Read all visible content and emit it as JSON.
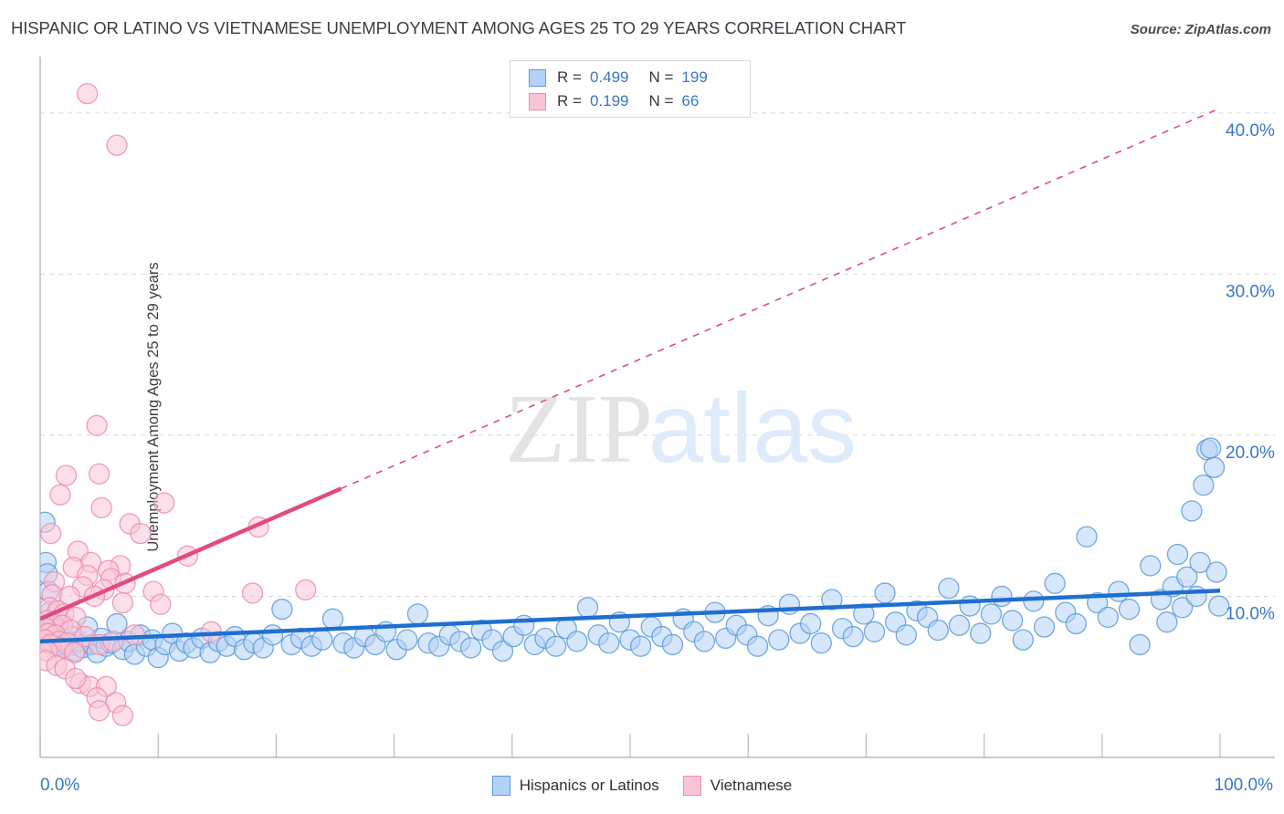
{
  "header": {
    "title": "HISPANIC OR LATINO VS VIETNAMESE UNEMPLOYMENT AMONG AGES 25 TO 29 YEARS CORRELATION CHART",
    "source": "Source: ZipAtlas.com"
  },
  "watermark": {
    "part1": "ZIP",
    "part2": "atlas"
  },
  "axes": {
    "ylabel": "Unemployment Among Ages 25 to 29 years",
    "y_ticks": [
      "40.0%",
      "30.0%",
      "20.0%",
      "10.0%"
    ],
    "x_min_label": "0.0%",
    "x_max_label": "100.0%"
  },
  "legend": {
    "rows": [
      {
        "swatch": "blue",
        "r_key": "R =",
        "r_value": "0.499",
        "n_key": "N =",
        "n_value": "199"
      },
      {
        "swatch": "pink",
        "r_key": "R =",
        "r_value": "0.199",
        "n_key": "N =",
        "n_value": "66"
      }
    ]
  },
  "series_legend": [
    {
      "label": "Hispanics or Latinos",
      "color": "#b4d2f7",
      "border": "#5b9bd5"
    },
    {
      "label": "Vietnamese",
      "color": "#fac4d6",
      "border": "#ef8bb0"
    }
  ],
  "colors": {
    "blue_fill": "#b4d2f7",
    "blue_stroke": "#5b9bd5",
    "pink_fill": "#fac4d6",
    "pink_stroke": "#ef8bb0",
    "blue_line": "#1f6fd0",
    "pink_line": "#e14b7f",
    "tick_text": "#3a76c4",
    "grid": "#d8d8dd",
    "axis": "#b9b9c2"
  },
  "chart_data": {
    "type": "scatter",
    "title": "HISPANIC OR LATINO VS VIETNAMESE UNEMPLOYMENT AMONG AGES 25 TO 29 YEARS CORRELATION CHART",
    "xlabel": "",
    "ylabel": "Unemployment Among Ages 25 to 29 years",
    "xlim": [
      0,
      100
    ],
    "ylim": [
      0,
      43.5
    ],
    "x_ticks": [
      0,
      100
    ],
    "x_tick_labels": [
      "0.0%",
      "100.0%"
    ],
    "y_ticks": [
      10,
      20,
      30,
      40
    ],
    "y_tick_labels": [
      "10.0%",
      "20.0%",
      "30.0%",
      "40.0%"
    ],
    "grid": "horizontal-dashed",
    "legend_position": "top-center",
    "series": [
      {
        "name": "Hispanics or Latinos",
        "color": "#b4d2f7",
        "r": 0.499,
        "n": 199,
        "trend": {
          "style": "solid",
          "x0": 0,
          "y0": 7.2,
          "x1": 100,
          "y1": 10.35
        },
        "points": [
          [
            0.4,
            14.6
          ],
          [
            0.5,
            12.1
          ],
          [
            0.6,
            11.4
          ],
          [
            0.7,
            10.3
          ],
          [
            0.8,
            9.0
          ],
          [
            0.9,
            8.2
          ],
          [
            1.0,
            7.6
          ],
          [
            1.1,
            7.1
          ],
          [
            1.3,
            7.4
          ],
          [
            1.5,
            8.0
          ],
          [
            1.7,
            7.0
          ],
          [
            1.9,
            6.8
          ],
          [
            2.1,
            7.3
          ],
          [
            2.4,
            6.9
          ],
          [
            2.7,
            7.5
          ],
          [
            3.0,
            6.6
          ],
          [
            3.3,
            7.2
          ],
          [
            3.6,
            6.8
          ],
          [
            4.0,
            8.1
          ],
          [
            4.4,
            7.0
          ],
          [
            4.8,
            6.5
          ],
          [
            5.2,
            7.4
          ],
          [
            5.6,
            6.9
          ],
          [
            6.0,
            7.1
          ],
          [
            6.5,
            8.3
          ],
          [
            7.0,
            6.7
          ],
          [
            7.5,
            7.2
          ],
          [
            8.0,
            6.4
          ],
          [
            8.5,
            7.6
          ],
          [
            9.0,
            6.9
          ],
          [
            9.5,
            7.3
          ],
          [
            10.0,
            6.2
          ],
          [
            10.6,
            7.0
          ],
          [
            11.2,
            7.7
          ],
          [
            11.8,
            6.6
          ],
          [
            12.4,
            7.1
          ],
          [
            13.0,
            6.8
          ],
          [
            13.7,
            7.4
          ],
          [
            14.4,
            6.5
          ],
          [
            15.1,
            7.2
          ],
          [
            15.8,
            6.9
          ],
          [
            16.5,
            7.5
          ],
          [
            17.3,
            6.7
          ],
          [
            18.1,
            7.1
          ],
          [
            18.9,
            6.8
          ],
          [
            19.7,
            7.6
          ],
          [
            20.5,
            9.2
          ],
          [
            21.3,
            7.0
          ],
          [
            22.1,
            7.4
          ],
          [
            23.0,
            6.9
          ],
          [
            23.9,
            7.3
          ],
          [
            24.8,
            8.6
          ],
          [
            25.7,
            7.1
          ],
          [
            26.6,
            6.8
          ],
          [
            27.5,
            7.5
          ],
          [
            28.4,
            7.0
          ],
          [
            29.3,
            7.8
          ],
          [
            30.2,
            6.7
          ],
          [
            31.1,
            7.3
          ],
          [
            32.0,
            8.9
          ],
          [
            32.9,
            7.1
          ],
          [
            33.8,
            6.9
          ],
          [
            34.7,
            7.6
          ],
          [
            35.6,
            7.2
          ],
          [
            36.5,
            6.8
          ],
          [
            37.4,
            7.9
          ],
          [
            38.3,
            7.3
          ],
          [
            39.2,
            6.6
          ],
          [
            40.1,
            7.5
          ],
          [
            41.0,
            8.2
          ],
          [
            41.9,
            7.0
          ],
          [
            42.8,
            7.4
          ],
          [
            43.7,
            6.9
          ],
          [
            44.6,
            8.0
          ],
          [
            45.5,
            7.2
          ],
          [
            46.4,
            9.3
          ],
          [
            47.3,
            7.6
          ],
          [
            48.2,
            7.1
          ],
          [
            49.1,
            8.4
          ],
          [
            50.0,
            7.3
          ],
          [
            50.9,
            6.9
          ],
          [
            51.8,
            8.1
          ],
          [
            52.7,
            7.5
          ],
          [
            53.6,
            7.0
          ],
          [
            54.5,
            8.6
          ],
          [
            55.4,
            7.8
          ],
          [
            56.3,
            7.2
          ],
          [
            57.2,
            9.0
          ],
          [
            58.1,
            7.4
          ],
          [
            59.0,
            8.2
          ],
          [
            59.9,
            7.6
          ],
          [
            60.8,
            6.9
          ],
          [
            61.7,
            8.8
          ],
          [
            62.6,
            7.3
          ],
          [
            63.5,
            9.5
          ],
          [
            64.4,
            7.7
          ],
          [
            65.3,
            8.3
          ],
          [
            66.2,
            7.1
          ],
          [
            67.1,
            9.8
          ],
          [
            68.0,
            8.0
          ],
          [
            68.9,
            7.5
          ],
          [
            69.8,
            8.9
          ],
          [
            70.7,
            7.8
          ],
          [
            71.6,
            10.2
          ],
          [
            72.5,
            8.4
          ],
          [
            73.4,
            7.6
          ],
          [
            74.3,
            9.1
          ],
          [
            75.2,
            8.7
          ],
          [
            76.1,
            7.9
          ],
          [
            77.0,
            10.5
          ],
          [
            77.9,
            8.2
          ],
          [
            78.8,
            9.4
          ],
          [
            79.7,
            7.7
          ],
          [
            80.6,
            8.9
          ],
          [
            81.5,
            10.0
          ],
          [
            82.4,
            8.5
          ],
          [
            83.3,
            7.3
          ],
          [
            84.2,
            9.7
          ],
          [
            85.1,
            8.1
          ],
          [
            86.0,
            10.8
          ],
          [
            86.9,
            9.0
          ],
          [
            87.8,
            8.3
          ],
          [
            88.7,
            13.7
          ],
          [
            89.6,
            9.6
          ],
          [
            90.5,
            8.7
          ],
          [
            91.4,
            10.3
          ],
          [
            92.3,
            9.2
          ],
          [
            93.2,
            7.0
          ],
          [
            94.1,
            11.9
          ],
          [
            95.0,
            9.8
          ],
          [
            95.5,
            8.4
          ],
          [
            96.0,
            10.6
          ],
          [
            96.4,
            12.6
          ],
          [
            96.8,
            9.3
          ],
          [
            97.2,
            11.2
          ],
          [
            97.6,
            15.3
          ],
          [
            98.0,
            10.0
          ],
          [
            98.3,
            12.1
          ],
          [
            98.6,
            16.9
          ],
          [
            98.9,
            19.1
          ],
          [
            99.2,
            19.2
          ],
          [
            99.5,
            18.0
          ],
          [
            99.7,
            11.5
          ],
          [
            99.9,
            9.4
          ]
        ]
      },
      {
        "name": "Vietnamese",
        "color": "#fac4d6",
        "r": 0.199,
        "n": 66,
        "trend": {
          "style": "solid-then-dashed",
          "x0": 0,
          "y0": 8.6,
          "x1": 100,
          "y1": 40.3,
          "dash_from_x": 25.5
        },
        "points": [
          [
            4.0,
            41.2
          ],
          [
            6.5,
            38.0
          ],
          [
            4.8,
            20.6
          ],
          [
            2.2,
            17.5
          ],
          [
            5.0,
            17.6
          ],
          [
            1.7,
            16.3
          ],
          [
            10.5,
            15.8
          ],
          [
            5.2,
            15.5
          ],
          [
            7.6,
            14.5
          ],
          [
            0.9,
            13.9
          ],
          [
            8.5,
            13.9
          ],
          [
            12.5,
            12.5
          ],
          [
            18.5,
            14.3
          ],
          [
            3.2,
            12.8
          ],
          [
            4.3,
            12.1
          ],
          [
            2.8,
            11.8
          ],
          [
            6.8,
            11.9
          ],
          [
            5.8,
            11.6
          ],
          [
            4.0,
            11.3
          ],
          [
            6.0,
            11.1
          ],
          [
            1.2,
            10.9
          ],
          [
            7.2,
            10.8
          ],
          [
            3.6,
            10.6
          ],
          [
            5.4,
            10.4
          ],
          [
            9.6,
            10.3
          ],
          [
            1.0,
            10.1
          ],
          [
            2.5,
            10.0
          ],
          [
            4.6,
            10.0
          ],
          [
            7.0,
            9.6
          ],
          [
            10.2,
            9.5
          ],
          [
            18.0,
            10.2
          ],
          [
            22.5,
            10.4
          ],
          [
            0.8,
            9.3
          ],
          [
            1.5,
            9.1
          ],
          [
            2.0,
            8.9
          ],
          [
            3.0,
            8.7
          ],
          [
            0.6,
            8.5
          ],
          [
            1.1,
            8.3
          ],
          [
            1.9,
            8.2
          ],
          [
            0.5,
            8.0
          ],
          [
            2.6,
            7.9
          ],
          [
            0.7,
            7.7
          ],
          [
            1.3,
            7.6
          ],
          [
            3.8,
            7.5
          ],
          [
            0.4,
            7.3
          ],
          [
            1.6,
            7.2
          ],
          [
            2.3,
            7.1
          ],
          [
            0.9,
            7.0
          ],
          [
            5.0,
            7.0
          ],
          [
            1.8,
            6.8
          ],
          [
            0.6,
            6.6
          ],
          [
            2.9,
            6.5
          ],
          [
            6.2,
            7.2
          ],
          [
            8.0,
            7.6
          ],
          [
            14.5,
            7.8
          ],
          [
            0.5,
            6.0
          ],
          [
            1.4,
            5.7
          ],
          [
            2.1,
            5.5
          ],
          [
            3.4,
            4.6
          ],
          [
            4.2,
            4.4
          ],
          [
            5.6,
            4.4
          ],
          [
            4.8,
            3.7
          ],
          [
            6.4,
            3.4
          ],
          [
            5.0,
            2.9
          ],
          [
            7.0,
            2.6
          ],
          [
            3.0,
            4.9
          ]
        ]
      }
    ]
  }
}
